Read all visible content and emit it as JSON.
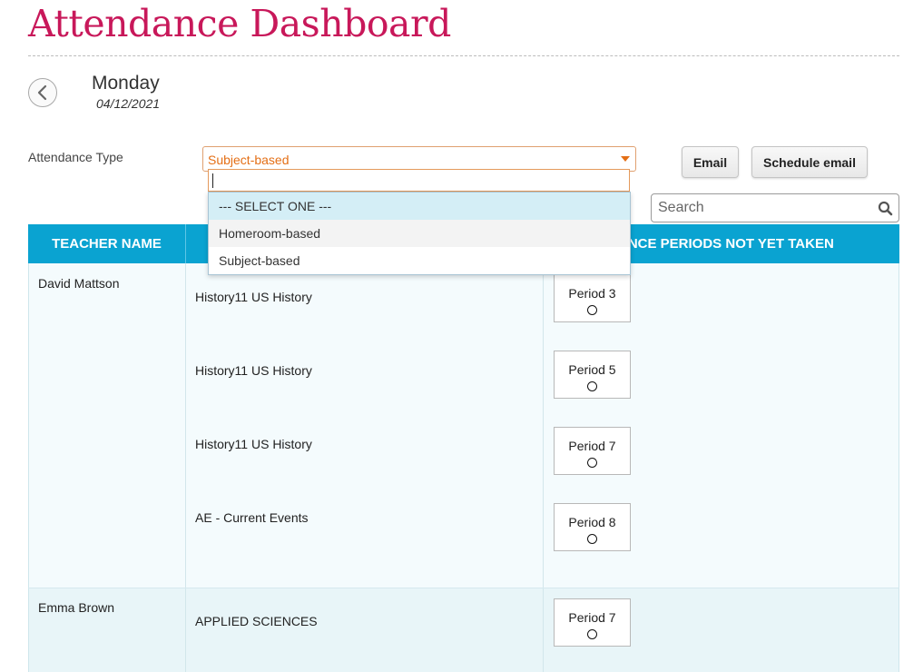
{
  "header": {
    "title": "Attendance Dashboard"
  },
  "date": {
    "day": "Monday",
    "date": "04/12/2021"
  },
  "controls": {
    "attendance_type_label": "Attendance Type",
    "attendance_type_value": "Subject-based",
    "dropdown_options": [
      "--- SELECT ONE ---",
      "Homeroom-based",
      "Subject-based"
    ],
    "email_label": "Email",
    "schedule_email_label": "Schedule email",
    "search_placeholder": "Search"
  },
  "table": {
    "headers": {
      "teacher": "TEACHER NAME",
      "periods": "DANCE PERIODS NOT YET TAKEN"
    },
    "groups": [
      {
        "teacher": "David Mattson",
        "rows": [
          {
            "subject": "History11 US History",
            "period": "Period 3"
          },
          {
            "subject": "History11 US History",
            "period": "Period 5"
          },
          {
            "subject": "History11 US History",
            "period": "Period 7"
          },
          {
            "subject": "AE - Current Events",
            "period": "Period 8"
          }
        ]
      },
      {
        "teacher": "Emma Brown",
        "rows": [
          {
            "subject": "APPLIED SCIENCES",
            "period": "Period 7"
          }
        ]
      }
    ]
  },
  "colors": {
    "title": "#c8185a",
    "accent": "#e46f16",
    "header_bg": "#0aa3d1"
  }
}
